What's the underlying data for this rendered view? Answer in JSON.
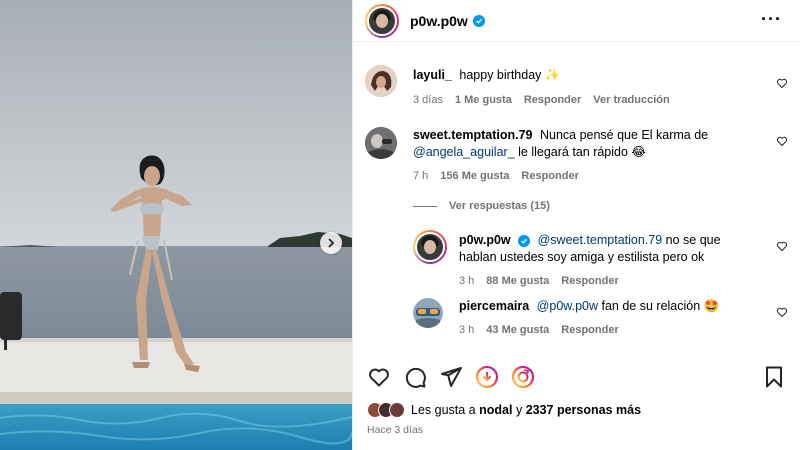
{
  "post": {
    "username": "p0w.p0w",
    "more_icon": "more-horizontal-icon"
  },
  "comments": [
    {
      "user": "layuli_",
      "text": "happy birthday",
      "emoji": "✨",
      "time": "3 días",
      "likes": "1 Me gusta",
      "reply": "Responder",
      "translate": "Ver traducción"
    },
    {
      "user": "sweet.temptation.79",
      "text_a": "Nunca pensé que El karma de",
      "mention": "@angela_aguilar_",
      "text_b": "le llegará tan rápido",
      "emoji": "😂",
      "time": "7 h",
      "likes": "156 Me gusta",
      "reply": "Responder",
      "view_replies": "Ver respuestas (15)"
    }
  ],
  "replies": [
    {
      "user": "p0w.p0w",
      "mention": "@sweet.temptation.79",
      "text": "no se que hablan ustedes soy amiga y estilista pero ok",
      "time": "3 h",
      "likes": "88 Me gusta",
      "reply": "Responder"
    },
    {
      "user": "piercemaira",
      "mention": "@p0w.p0w",
      "text": "fan de su relación",
      "emoji": "🤩",
      "time": "3 h",
      "likes": "43 Me gusta",
      "reply": "Responder"
    }
  ],
  "footer": {
    "likes_prefix": "Les gusta a",
    "likes_user": "nodal",
    "likes_middle": "y",
    "likes_count": "2337 personas más",
    "date": "Hace 3 días"
  },
  "colors": {
    "verified": "#0095f6",
    "mention": "#00376b",
    "meta": "#737373"
  }
}
